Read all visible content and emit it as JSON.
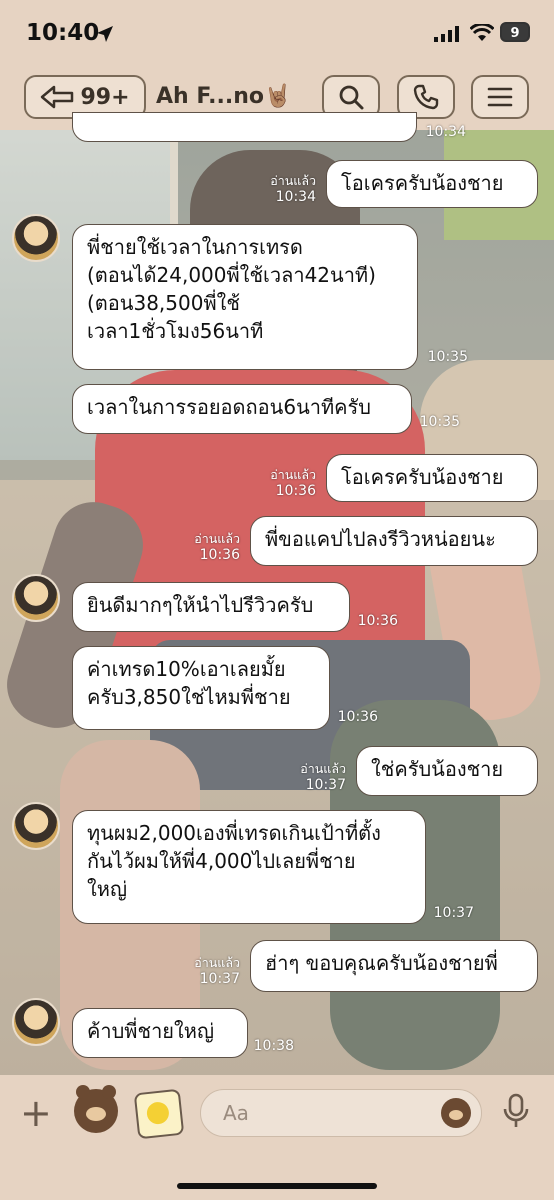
{
  "status_bar": {
    "time": "10:40",
    "battery": "9"
  },
  "header": {
    "back_count": "99+",
    "chat_title": "Ah F...no🤘🏽"
  },
  "messages": [
    {
      "side": "right",
      "text": "โอเครครับน้องชาย",
      "read": "อ่านแล้ว",
      "time": "10:34"
    },
    {
      "side": "left",
      "text": "พี่ชายใช้เวลาในการเทรด\n(ตอนได้24,000พี่ใช้เวลา42นาที)\n(ตอน38,500พี่ใช้\nเวลา1ชั่วโมง56นาที",
      "time": "10:35"
    },
    {
      "side": "left",
      "text": "เวลาในการรอยอดถอน6นาทีครับ",
      "time": "10:35"
    },
    {
      "side": "right",
      "text": "โอเครครับน้องชาย",
      "read": "อ่านแล้ว",
      "time": "10:36"
    },
    {
      "side": "right",
      "text": "พี่ขอแคปไปลงรีวิวหน่อยนะ",
      "read": "อ่านแล้ว",
      "time": "10:36"
    },
    {
      "side": "left",
      "text": "ยินดีมากๆให้นำไปรีวิวครับ",
      "time": "10:36"
    },
    {
      "side": "left",
      "text": "ค่าเทรด10%เอาเลยมั้ย\nครับ3,850ใช่ไหมพี่ชาย",
      "time": "10:36"
    },
    {
      "side": "right",
      "text": "ใช่ครับน้องชาย",
      "read": "อ่านแล้ว",
      "time": "10:37"
    },
    {
      "side": "left",
      "text": "ทุนผม2,000เองพี่เทรดเกินเป้าที่ตั้ง\nกันไว้ผมให้พี่4,000ไปเลยพี่ชาย\nใหญ่",
      "time": "10:37"
    },
    {
      "side": "right",
      "text": "ฮ่าๆ ขอบคุณครับน้องชายพี่",
      "read": "อ่านแล้ว",
      "time": "10:37"
    },
    {
      "side": "left",
      "text": "ค้าบพี่ชายใหญ่",
      "time": "10:38"
    }
  ],
  "top_partial_time": "10:34",
  "composer": {
    "placeholder": "Aa"
  }
}
